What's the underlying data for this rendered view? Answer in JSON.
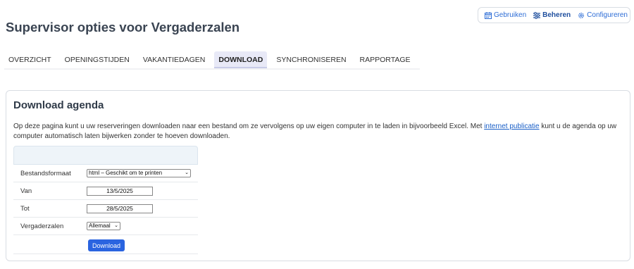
{
  "topnav": {
    "items": [
      {
        "label": "Gebruiken",
        "icon": "calendar-icon"
      },
      {
        "label": "Beheren",
        "icon": "sliders-icon"
      },
      {
        "label": "Configureren",
        "icon": "gear-icon"
      }
    ]
  },
  "page_title": "Supervisor opties voor Vergaderzalen",
  "tabs": [
    {
      "label": "OVERZICHT"
    },
    {
      "label": "OPENINGSTIJDEN"
    },
    {
      "label": "VAKANTIEDAGEN"
    },
    {
      "label": "DOWNLOAD",
      "active": true
    },
    {
      "label": "SYNCHRONISEREN"
    },
    {
      "label": "RAPPORTAGE"
    }
  ],
  "panel": {
    "title": "Download agenda",
    "desc_before": "Op deze pagina kunt u uw reserveringen downloaden naar een bestand om ze vervolgens op uw eigen computer in te laden in bijvoorbeeld Excel. Met ",
    "desc_link": "internet publicatie",
    "desc_after": " kunt u de agenda op uw computer automatisch laten bijwerken zonder te hoeven downloaden."
  },
  "form": {
    "format_label": "Bestandsformaat",
    "format_value": "html – Geschikt om te printen",
    "van_label": "Van",
    "van_value": "13/5/2025",
    "tot_label": "Tot",
    "tot_value": "28/5/2025",
    "rooms_label": "Vergaderzalen",
    "rooms_value": "Allemaal",
    "download_label": "Download"
  },
  "colors": {
    "accent": "#2a64e0",
    "link": "#1a5fc7",
    "active_tab": "#e8e9f7"
  }
}
